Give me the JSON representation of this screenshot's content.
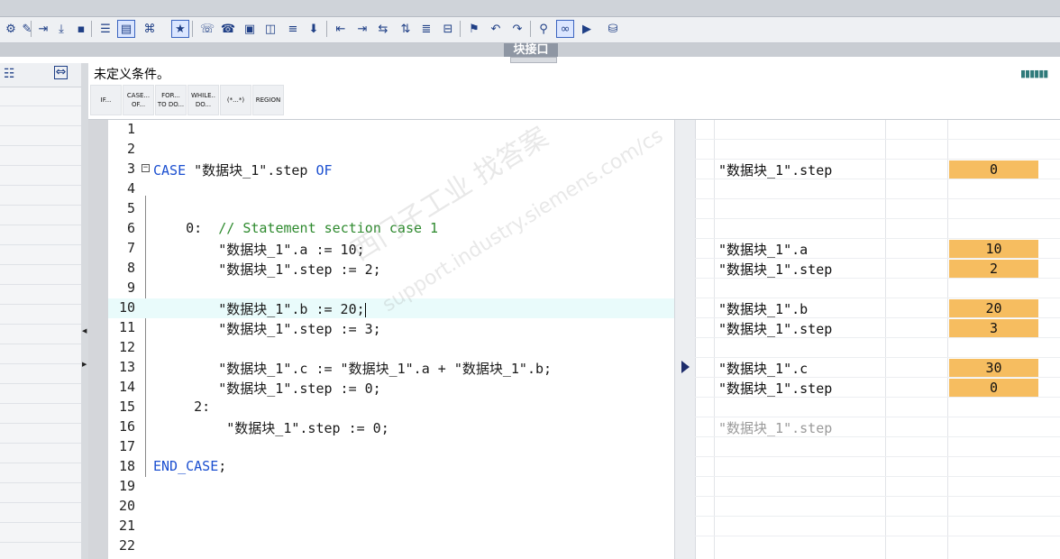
{
  "interface_tab": "块接口",
  "condition_text": "未定义条件。",
  "ctrl_buttons": [
    {
      "line1": "IF...",
      "line2": ""
    },
    {
      "line1": "CASE...",
      "line2": "OF..."
    },
    {
      "line1": "FOR...",
      "line2": "TO DO..."
    },
    {
      "line1": "WHILE..",
      "line2": "DO..."
    },
    {
      "line1": "(*...*)",
      "line2": ""
    },
    {
      "line1": "REGION",
      "line2": ""
    }
  ],
  "code_lines": [
    {
      "n": "1",
      "text": ""
    },
    {
      "n": "2",
      "text": ""
    },
    {
      "n": "3",
      "kw1": "CASE",
      "text": " \"数据块_1\".step ",
      "kw2": "OF"
    },
    {
      "n": "4",
      "text": ""
    },
    {
      "n": "5",
      "text": ""
    },
    {
      "n": "6",
      "pre": "    0:  ",
      "comment": "// Statement section case 1"
    },
    {
      "n": "7",
      "text": "        \"数据块_1\".a := 10;"
    },
    {
      "n": "8",
      "text": "        \"数据块_1\".step := 2;"
    },
    {
      "n": "9",
      "text": ""
    },
    {
      "n": "10",
      "text": "        \"数据块_1\".b := 20;"
    },
    {
      "n": "11",
      "text": "        \"数据块_1\".step := 3;"
    },
    {
      "n": "12",
      "text": ""
    },
    {
      "n": "13",
      "text": "        \"数据块_1\".c := \"数据块_1\".a + \"数据块_1\".b;"
    },
    {
      "n": "14",
      "text": "        \"数据块_1\".step := 0;"
    },
    {
      "n": "15",
      "text": "     2:"
    },
    {
      "n": "16",
      "text": "         \"数据块_1\".step := 0;"
    },
    {
      "n": "17",
      "text": ""
    },
    {
      "n": "18",
      "kw1": "END_CASE",
      "text": ";"
    },
    {
      "n": "19",
      "text": ""
    },
    {
      "n": "20",
      "text": ""
    },
    {
      "n": "21",
      "text": ""
    },
    {
      "n": "22",
      "text": ""
    }
  ],
  "monitor": [
    {
      "line": 3,
      "name": "\"数据块_1\".step",
      "value": "0"
    },
    {
      "line": 7,
      "name": "\"数据块_1\".a",
      "value": "10"
    },
    {
      "line": 8,
      "name": "\"数据块_1\".step",
      "value": "2"
    },
    {
      "line": 10,
      "name": "\"数据块_1\".b",
      "value": "20"
    },
    {
      "line": 11,
      "name": "\"数据块_1\".step",
      "value": "3"
    },
    {
      "line": 13,
      "name": "\"数据块_1\".c",
      "value": "30"
    },
    {
      "line": 14,
      "name": "\"数据块_1\".step",
      "value": "0"
    },
    {
      "line": 16,
      "name": "\"数据块_1\".step",
      "value": "",
      "dim": true
    }
  ],
  "watermark_line1": "西门子工业  找答案",
  "watermark_line2": "support.industry.siemens.com/cs",
  "colors": {
    "keyword": "#1b4fd0",
    "comment": "#2e8a2e",
    "value_cell": "#f6bd60",
    "highlight_line": "#e9fbfb"
  },
  "toolbar_icons": [
    "indent-icon",
    "outdent-icon",
    "insert-icon",
    "watch-icon",
    "list-icon",
    "monitor-icon",
    "snapshot-icon",
    "bookmark-icon",
    "call-icon",
    "go-icon",
    "comment-icon",
    "uncomment-icon",
    "find-icon",
    "glasses-icon",
    "db-icon"
  ]
}
